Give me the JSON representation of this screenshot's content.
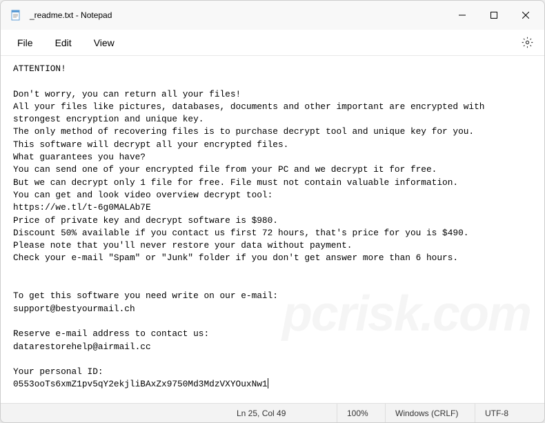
{
  "titlebar": {
    "title": "_readme.txt - Notepad"
  },
  "menu": {
    "file": "File",
    "edit": "Edit",
    "view": "View"
  },
  "content": {
    "text": "ATTENTION!\n\nDon't worry, you can return all your files!\nAll your files like pictures, databases, documents and other important are encrypted with strongest encryption and unique key.\nThe only method of recovering files is to purchase decrypt tool and unique key for you.\nThis software will decrypt all your encrypted files.\nWhat guarantees you have?\nYou can send one of your encrypted file from your PC and we decrypt it for free.\nBut we can decrypt only 1 file for free. File must not contain valuable information.\nYou can get and look video overview decrypt tool:\nhttps://we.tl/t-6g0MALAb7E\nPrice of private key and decrypt software is $980.\nDiscount 50% available if you contact us first 72 hours, that's price for you is $490.\nPlease note that you'll never restore your data without payment.\nCheck your e-mail \"Spam\" or \"Junk\" folder if you don't get answer more than 6 hours.\n\n\nTo get this software you need write on our e-mail:\nsupport@bestyourmail.ch\n\nReserve e-mail address to contact us:\ndatarestorehelp@airmail.cc\n\nYour personal ID:\n0553ooTs6xmZ1pv5qY2ekjliBAxZx9750Md3MdzVXYOuxNw1"
  },
  "statusbar": {
    "position": "Ln 25, Col 49",
    "zoom": "100%",
    "lineending": "Windows (CRLF)",
    "encoding": "UTF-8"
  },
  "watermark": "pcrisk.com"
}
